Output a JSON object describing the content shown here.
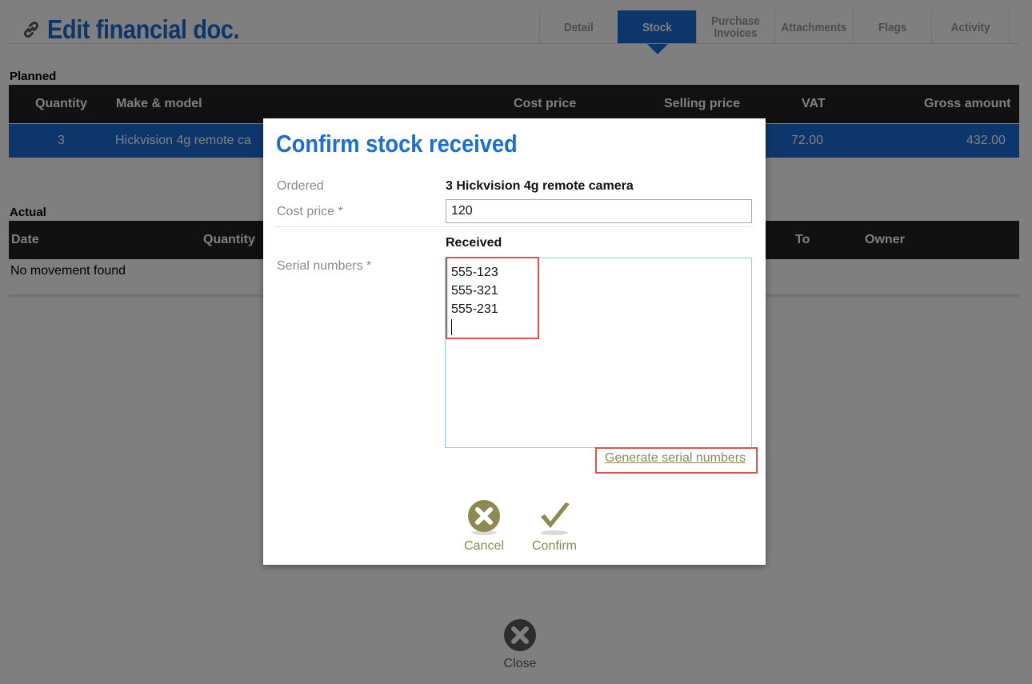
{
  "page": {
    "title": "Edit financial doc.",
    "tabs": [
      {
        "label": "Detail",
        "active": false
      },
      {
        "label": "Stock",
        "active": true
      },
      {
        "label": "Purchase Invoices",
        "active": false
      },
      {
        "label": "Attachments",
        "active": false
      },
      {
        "label": "Flags",
        "active": false
      },
      {
        "label": "Activity",
        "active": false
      }
    ],
    "planned": {
      "label": "Planned",
      "columns": [
        "Quantity",
        "Make & model",
        "Cost price",
        "Selling price",
        "VAT",
        "Gross amount"
      ],
      "row": {
        "quantity": "3",
        "model": "Hickvision 4g remote ca",
        "vat": "72.00",
        "gross": "432.00"
      }
    },
    "actual": {
      "label": "Actual",
      "columns": [
        "Date",
        "Quantity",
        "To",
        "Owner"
      ],
      "empty_text": "No movement found"
    },
    "close_label": "Close"
  },
  "modal": {
    "title": "Confirm stock received",
    "ordered_label": "Ordered",
    "ordered_value": "3 Hickvision 4g remote camera",
    "cost_label": "Cost price *",
    "cost_value": "120",
    "received_heading": "Received",
    "serial_label": "Serial numbers *",
    "serials": [
      "555-123",
      "555-321",
      "555-231"
    ],
    "generate_link": "Generate serial numbers",
    "cancel_label": "Cancel",
    "confirm_label": "Confirm"
  },
  "colors": {
    "accent": "#1a6fd6",
    "header_bar": "#222222",
    "action_olive": "#8c8a52",
    "highlight": "#d9534f"
  }
}
